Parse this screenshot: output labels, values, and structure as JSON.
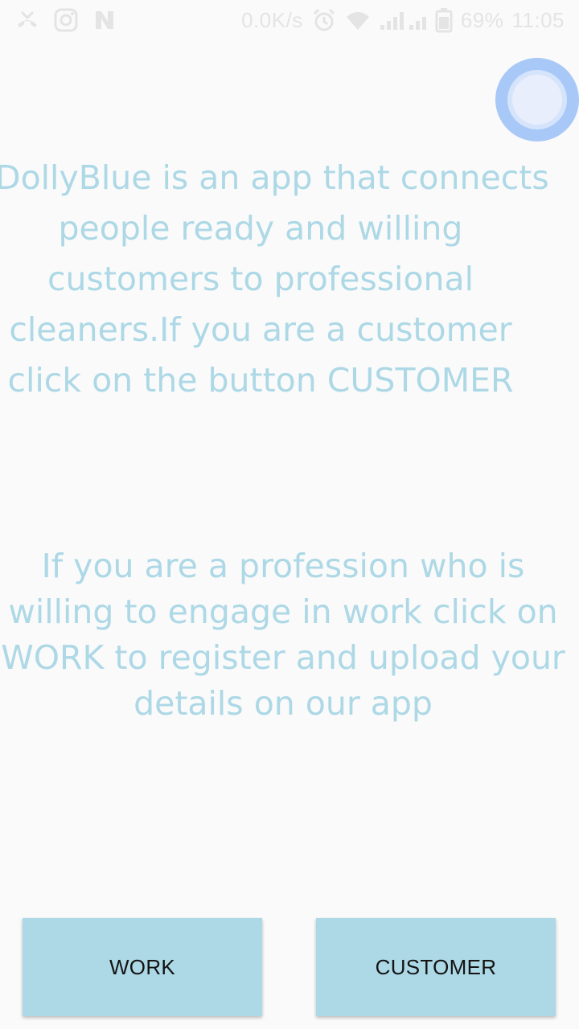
{
  "status_bar": {
    "left_icons": [
      "missed-call-icon",
      "instagram-icon",
      "n-notification-icon"
    ],
    "net_speed": "0.0K/s",
    "right_icons": [
      "alarm-icon",
      "wifi-icon",
      "signal-icon",
      "battery-icon"
    ],
    "battery_level": "69%",
    "time": "11:05"
  },
  "intro": {
    "customer_lines": [
      "DollyBlue is an app that connects",
      "people ready and willing",
      "customers to professional",
      "cleaners.If you are a customer",
      "click on the button CUSTOMER"
    ],
    "work_lines": [
      "If you are a profession who is",
      "willing to engage in work click on",
      "WORK to register and upload your",
      "details on our app"
    ]
  },
  "buttons": {
    "work_label": "WORK",
    "customer_label": "CUSTOMER"
  },
  "colors": {
    "background": "#fafafa",
    "text_accent": "#add8e6",
    "button_bg": "#add8e6",
    "button_text": "#141414",
    "bubble": "#a8c8f7"
  }
}
